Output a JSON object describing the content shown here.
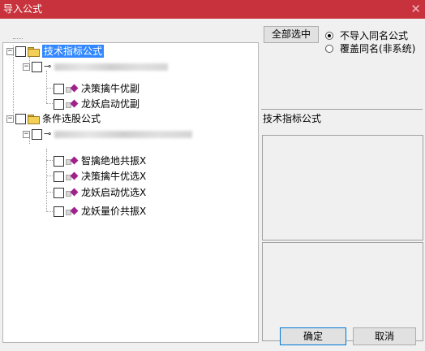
{
  "window": {
    "title": "导入公式",
    "close_glyph": "✕"
  },
  "tree": {
    "root1_label": "技术指标公式",
    "root1_item1": "决策擒牛优副",
    "root1_item2": "龙妖启动优副",
    "root2_label": "条件选股公式",
    "root2_item1": "智擒绝地共振X",
    "root2_item2": "决策擒牛优选X",
    "root2_item3": "龙妖启动优选X",
    "root2_item4": "龙妖量价共振X",
    "expander_glyph": "−",
    "key_glyph": "⊸"
  },
  "options": {
    "select_all_label": "全部选中",
    "radio1_label": "不导入同名公式",
    "radio2_label": "覆盖同名(非系统)",
    "radio1_checked": true
  },
  "info": {
    "formula_type_label": "技术指标公式"
  },
  "footer": {
    "ok_label": "确定",
    "cancel_label": "取消"
  },
  "colors": {
    "titlebar": "#c8323c",
    "selection": "#3388ff",
    "diamond": "#a0208e"
  }
}
